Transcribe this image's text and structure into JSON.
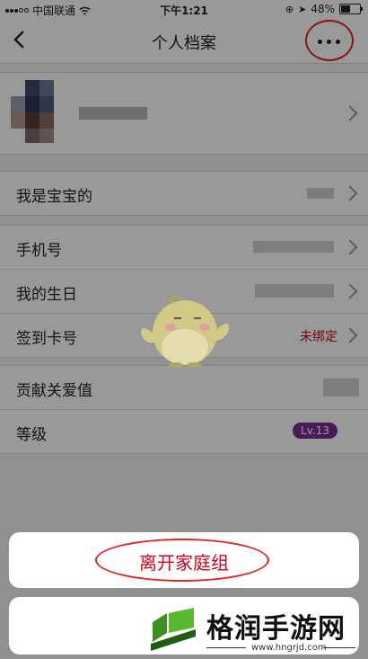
{
  "status_bar": {
    "carrier": "中国联通",
    "time": "下午1:21",
    "battery": "48%"
  },
  "nav": {
    "back_icon": "chevron-left-icon",
    "title": "个人档案",
    "more_icon": "more-dots-icon"
  },
  "rows": {
    "relation": "我是宝宝的",
    "phone": "手机号",
    "birthday": "我的生日",
    "card": "签到卡号",
    "card_value": "未绑定",
    "love": "贡献关爱值",
    "level": "等级",
    "level_badge": "Lv.13"
  },
  "sheet": {
    "leave_label": "离开家庭组"
  },
  "watermark": {
    "title": "格润手游网",
    "url": "www.hngrjd.com"
  },
  "colors": {
    "accent_red": "#d0021b",
    "annotation_ring": "#e32222",
    "level_badge": "#7a2c8f"
  }
}
